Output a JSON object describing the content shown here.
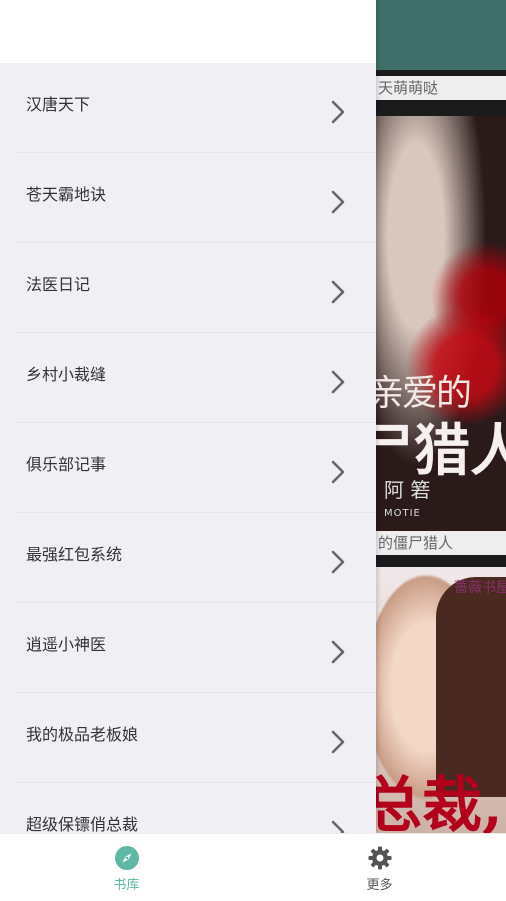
{
  "background": {
    "captions": [
      "天萌萌哒",
      "的僵尸猎人"
    ],
    "cover1_text": {
      "line1": "亲爱的",
      "line2": "尸猎人",
      "author": "阿 箬",
      "publisher": "MOTIE"
    },
    "cover2_text": {
      "brand": "蔷薇书屋",
      "big": "总裁,"
    }
  },
  "drawer": {
    "items": [
      {
        "label": "汉唐天下"
      },
      {
        "label": "苍天霸地诀"
      },
      {
        "label": "法医日记"
      },
      {
        "label": "乡村小裁缝"
      },
      {
        "label": "俱乐部记事"
      },
      {
        "label": "最强红包系统"
      },
      {
        "label": "逍遥小神医"
      },
      {
        "label": "我的极品老板娘"
      },
      {
        "label": "超级保镖俏总裁"
      }
    ],
    "chevron_icon": "chevron-right-icon"
  },
  "bottom_nav": {
    "library": {
      "label": "书库",
      "icon": "compass-icon",
      "color": "#5fb8a3"
    },
    "more": {
      "label": "更多",
      "icon": "gear-icon",
      "color": "#555555"
    }
  }
}
